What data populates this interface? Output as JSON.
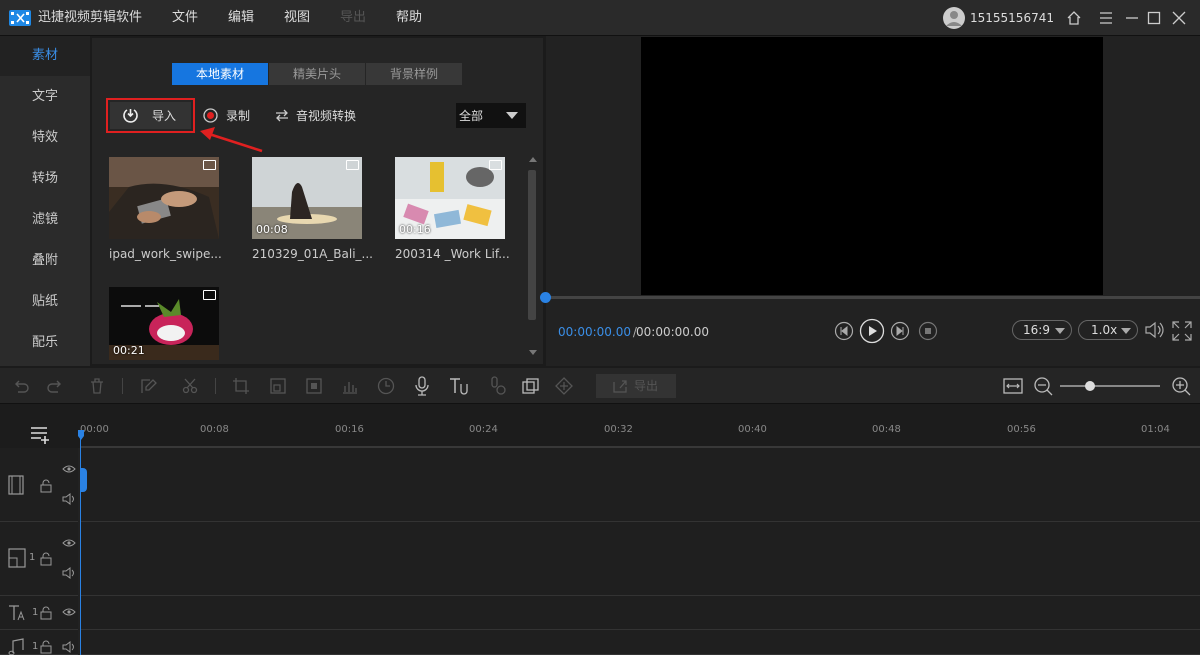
{
  "app": {
    "title": "迅捷视频剪辑软件"
  },
  "menu": {
    "file": "文件",
    "edit": "编辑",
    "view": "视图",
    "export": "导出",
    "help": "帮助"
  },
  "user": {
    "phone": "15155156741"
  },
  "sidebar": {
    "items": [
      {
        "label": "素材"
      },
      {
        "label": "文字"
      },
      {
        "label": "特效"
      },
      {
        "label": "转场"
      },
      {
        "label": "滤镜"
      },
      {
        "label": "叠附"
      },
      {
        "label": "贴纸"
      },
      {
        "label": "配乐"
      }
    ]
  },
  "media": {
    "tabs": [
      {
        "label": "本地素材"
      },
      {
        "label": "精美片头"
      },
      {
        "label": "背景样例"
      }
    ],
    "import_label": "导入",
    "record_label": "录制",
    "convert_label": "音视频转换",
    "filter_value": "全部",
    "items": [
      {
        "name": "ipad_work_swipe...",
        "duration": ""
      },
      {
        "name": "210329_01A_Bali_...",
        "duration": "00:08"
      },
      {
        "name": "200314 _Work Lif...",
        "duration": "00:16"
      },
      {
        "name": "",
        "duration": "00:21"
      }
    ]
  },
  "preview": {
    "current_time": "00:00:00.00",
    "separator": " / ",
    "total_time": "00:00:00.00",
    "aspect": "16:9",
    "speed": "1.0x"
  },
  "timeline": {
    "export_label": "导出",
    "ticks": [
      "00:00",
      "00:08",
      "00:16",
      "00:24",
      "00:32",
      "00:40",
      "00:48",
      "00:56",
      "01:04"
    ],
    "track_num_1": "1",
    "track_num_2": "1",
    "track_num_3": "1"
  },
  "colors": {
    "accent": "#1676e0",
    "highlight": "#e02020",
    "playhead": "#2a82e4"
  }
}
